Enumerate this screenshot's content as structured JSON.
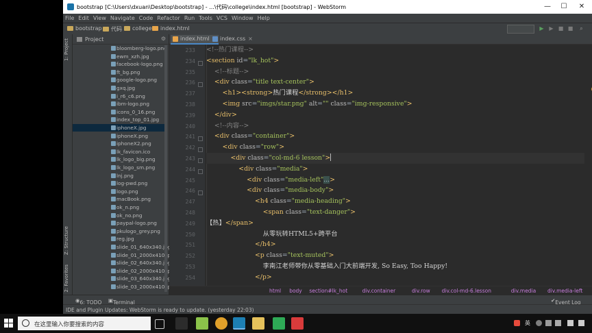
{
  "window": {
    "title": "bootstrap [C:\\Users\\dxuan\\Desktop\\bootstrap] - ...\\代码\\college\\index.html [bootstrap] - WebStorm",
    "minimize": "—",
    "maximize": "☐",
    "close": "✕"
  },
  "menu": [
    "File",
    "Edit",
    "View",
    "Navigate",
    "Code",
    "Refactor",
    "Run",
    "Tools",
    "VCS",
    "Window",
    "Help"
  ],
  "nav": {
    "crumbs": [
      "bootstrap",
      "代码",
      "college",
      "index.html"
    ]
  },
  "left_tools": {
    "project": "1: Project",
    "structure": "Z: Structure",
    "favorites": "2: Favorites"
  },
  "project_panel": {
    "title": "Project",
    "files": [
      "bloomberg-logo.png",
      "ewm_xzh.jpg",
      "facebook-logo.png",
      "ft_bg.png",
      "google-logo.png",
      "gxq.jpg",
      "i_r6_c6.png",
      "ibm-logo.png",
      "icons_0_16.png",
      "index_top_01.jpg",
      "iphoneX.jpg",
      "iphoneX.png",
      "iphoneX2.png",
      "lk_favicon.ico",
      "lk_logo_big.png",
      "lk_logo_sm.png",
      "lnj.png",
      "log-pwd.png",
      "logo.png",
      "macBook.png",
      "ok_n.png",
      "ok_no.png",
      "paypal-logo.png",
      "pkulogo_grey.png",
      "reg.jpg",
      "slide_01_640x340.jpg",
      "slide_01_2000x410.jpg",
      "slide_02_640x340.jpg",
      "slide_02_2000x410.jpg",
      "slide_03_640x340.jpg",
      "slide_03_2000x410.jpg"
    ],
    "selected_index": 10
  },
  "tabs": [
    {
      "label": "index.html",
      "active": true,
      "close": "×"
    },
    {
      "label": "index.css",
      "active": false,
      "close": "×"
    }
  ],
  "code": {
    "first_line": 233,
    "lines": [
      "<!--热门课程-->",
      "<section id=\"lk_hot\">",
      "    <!--标题-->",
      "    <div class=\"title text-center\">",
      "        <h1><strong>热门课程</strong></h1>",
      "        <img src=\"imgs/star.png\" alt=\"\" class=\"img-responsive\">",
      "    </div>",
      "    <!--内容-->",
      "    <div class=\"container\">",
      "        <div class=\"row\">",
      "            <div class=\"col-md-6 lesson\">",
      "                <div class=\"media\">",
      "                    <div class=\"media-left\"...>",
      "                    <div class=\"media-body\">",
      "                        <h4 class=\"media-heading\">",
      "                            <span class=\"text-danger\">",
      "【热】</span>",
      "                            从零玩转HTML5+跨平台",
      "                        </h4>",
      "                        <p class=\"text-muted\">",
      "                            李南江老师带你从零基础入门大前端开发, So Easy, Too Happy!",
      "                        </p>"
    ],
    "current_line": 243
  },
  "breadcrumbs": [
    "html",
    "body",
    "section#lk_hot",
    "div.container",
    "div.row",
    "div.col-md-6.lesson",
    "div.media",
    "div.media-left"
  ],
  "bottom_tools": {
    "todo": "6: TODO",
    "terminal": "Terminal",
    "event_log": "Event Log"
  },
  "status": {
    "message": "IDE and Plugin Updates: WebStorm is ready to update. (yesterday 22:03)"
  },
  "taskbar": {
    "search_placeholder": "在这里输入你要搜索的内容",
    "ime": "英"
  },
  "colors": {
    "tag": "#e8bf6a",
    "attr": "#bababa",
    "value": "#a5c25c",
    "comment": "#808080",
    "text": "#a9b7c6",
    "breadcrumb": "#c77edd",
    "selection": "#0d293e"
  }
}
